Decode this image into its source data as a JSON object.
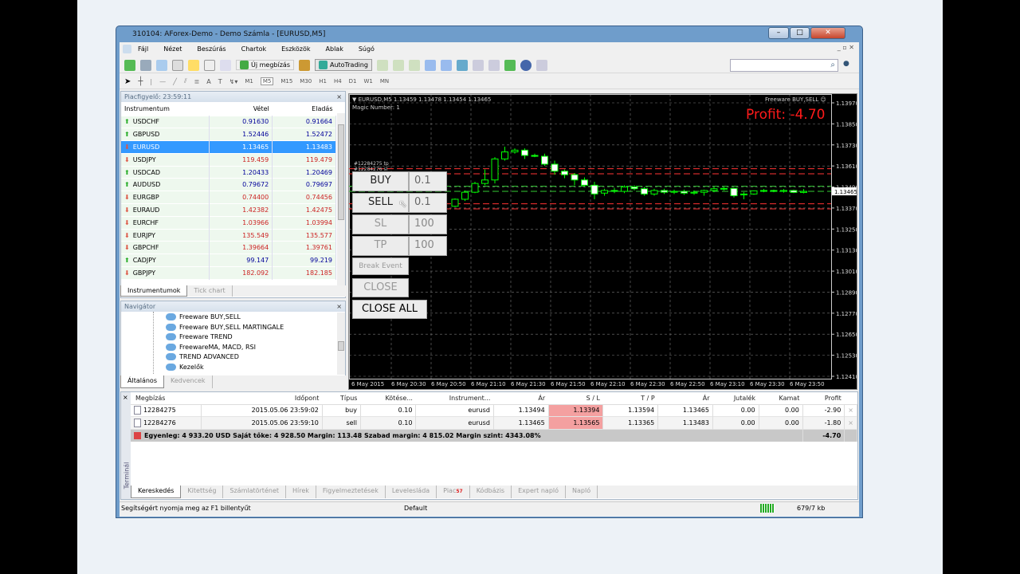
{
  "window": {
    "title": "310104: AForex-Demo - Demo Számla - [EURUSD,M5]"
  },
  "menu": [
    "Fájl",
    "Nézet",
    "Beszúrás",
    "Chartok",
    "Eszközök",
    "Ablak",
    "Súgó"
  ],
  "toolbar": {
    "new_order": "Új megbízás",
    "autotrading": "AutoTrading",
    "timeframes": [
      "M1",
      "M5",
      "M15",
      "M30",
      "H1",
      "H4",
      "D1",
      "W1",
      "MN"
    ],
    "active_timeframe": "M5"
  },
  "market_watch": {
    "title": "Piacfigyelő: 23:59:11",
    "columns": [
      "Instrumentum",
      "Vétel",
      "Eladás"
    ],
    "rows": [
      {
        "symbol": "USDCHF",
        "bid": "0.91630",
        "ask": "0.91664",
        "dir": "up"
      },
      {
        "symbol": "GBPUSD",
        "bid": "1.52446",
        "ask": "1.52472",
        "dir": "up"
      },
      {
        "symbol": "EURUSD",
        "bid": "1.13465",
        "ask": "1.13483",
        "dir": "dn",
        "selected": true
      },
      {
        "symbol": "USDJPY",
        "bid": "119.459",
        "ask": "119.479",
        "dir": "dn"
      },
      {
        "symbol": "USDCAD",
        "bid": "1.20433",
        "ask": "1.20469",
        "dir": "up"
      },
      {
        "symbol": "AUDUSD",
        "bid": "0.79672",
        "ask": "0.79697",
        "dir": "up"
      },
      {
        "symbol": "EURGBP",
        "bid": "0.74400",
        "ask": "0.74456",
        "dir": "dn"
      },
      {
        "symbol": "EURAUD",
        "bid": "1.42382",
        "ask": "1.42475",
        "dir": "dn"
      },
      {
        "symbol": "EURCHF",
        "bid": "1.03966",
        "ask": "1.03994",
        "dir": "dn"
      },
      {
        "symbol": "EURJPY",
        "bid": "135.549",
        "ask": "135.577",
        "dir": "dn"
      },
      {
        "symbol": "GBPCHF",
        "bid": "1.39664",
        "ask": "1.39761",
        "dir": "dn"
      },
      {
        "symbol": "CADJPY",
        "bid": "99.147",
        "ask": "99.219",
        "dir": "up"
      },
      {
        "symbol": "GBPJPY",
        "bid": "182.092",
        "ask": "182.185",
        "dir": "dn"
      }
    ],
    "tabs": [
      "Instrumentumok",
      "Tick chart"
    ]
  },
  "navigator": {
    "title": "Navigátor",
    "items": [
      "Freeware BUY,SELL",
      "Freeware BUY,SELL MARTINGALE",
      "Freeware TREND",
      "FreewareMA, MACD, RSI",
      "TREND ADVANCED",
      "Kezelők"
    ],
    "tabs": [
      "Általános",
      "Kedvencek"
    ]
  },
  "chart": {
    "header": "EURUSD,M5  1.13459 1.13478 1.13454 1.13465",
    "magic": "Magic Number: 1",
    "ea_name": "Freeware BUY,SELL",
    "profit_label": "Profit: -4.70",
    "order_labels": [
      "#12284275 tp",
      "#12284276 sl"
    ],
    "buttons": {
      "buy": "BUY",
      "buy_lot": "0.1",
      "sell": "SELL",
      "sell_lot": "0.1",
      "sl": "SL",
      "sl_val": "100",
      "tp": "TP",
      "tp_val": "100",
      "break_event": "Break Event",
      "close": "CLOSE",
      "close_all": "CLOSE ALL"
    },
    "colors": {
      "bg": "#000000",
      "bull": "#00ff00",
      "bear_fill": "#ffffff",
      "sl_tp_line": "#ff3333",
      "entry_line": "#33cc33",
      "profit": "#ff1a1a"
    }
  },
  "chart_data": {
    "type": "candlestick",
    "symbol": "EURUSD",
    "timeframe": "M5",
    "current_price": "1.13465",
    "y_ticks": [
      "1.13970",
      "1.13850",
      "1.13730",
      "1.13610",
      "1.13490",
      "1.13370",
      "1.13250",
      "1.13130",
      "1.13010",
      "1.12890",
      "1.12770",
      "1.12650",
      "1.12530",
      "1.12410"
    ],
    "ylim": [
      1.1241,
      1.1397
    ],
    "x_ticks": [
      "6 May 2015",
      "6 May 20:30",
      "6 May 20:50",
      "6 May 21:10",
      "6 May 21:30",
      "6 May 21:50",
      "6 May 22:10",
      "6 May 22:30",
      "6 May 22:50",
      "6 May 23:10",
      "6 May 23:30",
      "6 May 23:50"
    ],
    "lines": {
      "buy_open": 1.13494,
      "buy_sl": 1.13394,
      "buy_tp": 1.13594,
      "sell_open": 1.13465,
      "sell_sl": 1.13565,
      "sell_tp": 1.13365
    },
    "candles": [
      [
        "21:00",
        1.1338,
        1.13425,
        1.13375,
        1.1342
      ],
      [
        "21:05",
        1.1342,
        1.1347,
        1.1341,
        1.1346
      ],
      [
        "21:10",
        1.1346,
        1.1352,
        1.13455,
        1.1351
      ],
      [
        "21:15",
        1.1351,
        1.1359,
        1.135,
        1.1353
      ],
      [
        "21:20",
        1.1353,
        1.1366,
        1.1351,
        1.1365
      ],
      [
        "21:25",
        1.1365,
        1.1372,
        1.1364,
        1.1369
      ],
      [
        "21:30",
        1.1369,
        1.1371,
        1.1368,
        1.137
      ],
      [
        "21:35",
        1.137,
        1.1371,
        1.1365,
        1.1367
      ],
      [
        "21:40",
        1.1367,
        1.1368,
        1.1366,
        1.13665
      ],
      [
        "21:45",
        1.13665,
        1.1368,
        1.1361,
        1.1362
      ],
      [
        "21:50",
        1.1362,
        1.1364,
        1.1356,
        1.1358
      ],
      [
        "21:55",
        1.1358,
        1.1359,
        1.1354,
        1.1356
      ],
      [
        "22:00",
        1.1356,
        1.1357,
        1.135,
        1.1353
      ],
      [
        "22:05",
        1.1353,
        1.13545,
        1.1349,
        1.135
      ],
      [
        "22:10",
        1.135,
        1.1352,
        1.1342,
        1.1345
      ],
      [
        "22:15",
        1.13455,
        1.1348,
        1.1344,
        1.1347
      ],
      [
        "22:20",
        1.1347,
        1.13485,
        1.13455,
        1.13465
      ],
      [
        "22:25",
        1.13465,
        1.135,
        1.13455,
        1.1349
      ],
      [
        "22:30",
        1.1349,
        1.135,
        1.1347,
        1.1348
      ],
      [
        "22:35",
        1.1348,
        1.1349,
        1.1344,
        1.1345
      ],
      [
        "22:40",
        1.1345,
        1.1348,
        1.1344,
        1.1347
      ],
      [
        "22:45",
        1.1347,
        1.1348,
        1.1345,
        1.1346
      ],
      [
        "22:50",
        1.1346,
        1.13475,
        1.1345,
        1.13465
      ],
      [
        "22:55",
        1.13465,
        1.13475,
        1.13445,
        1.13455
      ],
      [
        "23:00",
        1.13455,
        1.1347,
        1.13445,
        1.1346
      ],
      [
        "23:05",
        1.1346,
        1.13475,
        1.1344,
        1.1347
      ],
      [
        "23:10",
        1.1347,
        1.1349,
        1.1346,
        1.1348
      ],
      [
        "23:15",
        1.1348,
        1.1349,
        1.1347,
        1.13482
      ],
      [
        "23:20",
        1.13482,
        1.13485,
        1.1343,
        1.1344
      ],
      [
        "23:25",
        1.13445,
        1.1346,
        1.1342,
        1.1345
      ],
      [
        "23:30",
        1.1345,
        1.1347,
        1.13445,
        1.13468
      ],
      [
        "23:35",
        1.13468,
        1.13478,
        1.1346,
        1.1347
      ],
      [
        "23:40",
        1.1347,
        1.13475,
        1.1346,
        1.13465
      ],
      [
        "23:45",
        1.13465,
        1.13478,
        1.13458,
        1.1347
      ],
      [
        "23:50",
        1.1347,
        1.13475,
        1.13455,
        1.13459
      ],
      [
        "23:55",
        1.13459,
        1.13478,
        1.13454,
        1.13465
      ]
    ]
  },
  "terminal": {
    "side_label": "Terminál",
    "columns": [
      "Megbízás",
      "Időpont",
      "Típus",
      "Kötése...",
      "Instrument...",
      "Ár",
      "S / L",
      "T / P",
      "Ár",
      "Jutalék",
      "Kamat",
      "Profit"
    ],
    "rows": [
      [
        "12284275",
        "2015.05.06 23:59:02",
        "buy",
        "0.10",
        "eurusd",
        "1.13494",
        "1.13394",
        "1.13594",
        "1.13465",
        "0.00",
        "0.00",
        "-2.90"
      ],
      [
        "12284276",
        "2015.05.06 23:59:10",
        "sell",
        "0.10",
        "eurusd",
        "1.13465",
        "1.13565",
        "1.13365",
        "1.13483",
        "0.00",
        "0.00",
        "-1.80"
      ]
    ],
    "summary": "Egyenleg: 4 933.20 USD  Saját tőke: 4 928.50  Margin: 113.48  Szabad margin: 4 815.02  Margin szint: 4343.08%",
    "summary_profit": "-4.70",
    "tabs": [
      "Kereskedés",
      "Kitettség",
      "Számlatörténet",
      "Hírek",
      "Figyelmeztetések",
      "Levelesláda",
      "Piac",
      "Kódbázis",
      "Expert napló",
      "Napló"
    ],
    "piac_badge": "57"
  },
  "status": {
    "help": "Segítségért nyomja meg az F1 billentyűt",
    "profile": "Default",
    "traffic": "679/7 kb"
  }
}
